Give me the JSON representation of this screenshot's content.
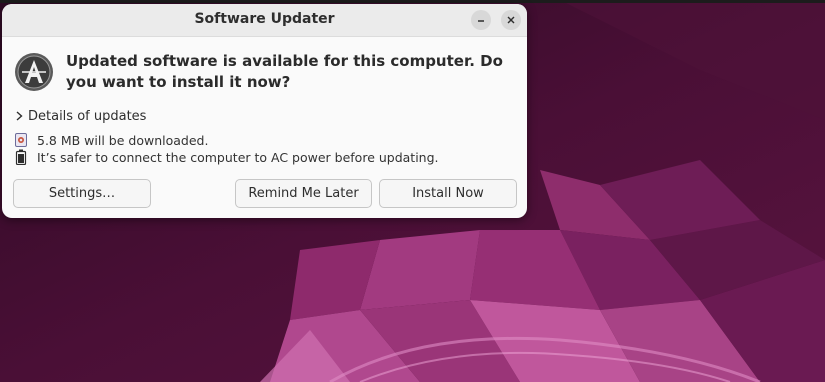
{
  "window": {
    "title": "Software Updater"
  },
  "dialog": {
    "headline": "Updated software is available for this computer. Do you want to install it now?",
    "details_label": "Details of updates",
    "download_info": "5.8 MB will be downloaded.",
    "power_warning": "It’s safer to connect the computer to AC power before updating."
  },
  "buttons": {
    "settings": "Settings…",
    "remind_later": "Remind Me Later",
    "install_now": "Install Now"
  },
  "icons": {
    "app": "software-updater-icon",
    "minimize": "minimize-icon",
    "close": "close-icon",
    "expander": "chevron-right-icon",
    "download": "download-package-icon",
    "battery": "battery-icon"
  },
  "colors": {
    "wallpaper_dark": "#3a0b2a",
    "wallpaper_mid": "#7a1f5c",
    "wallpaper_accent": "#b04a8e",
    "dialog_bg": "#fafafa",
    "titlebar_bg": "#ebebeb"
  }
}
